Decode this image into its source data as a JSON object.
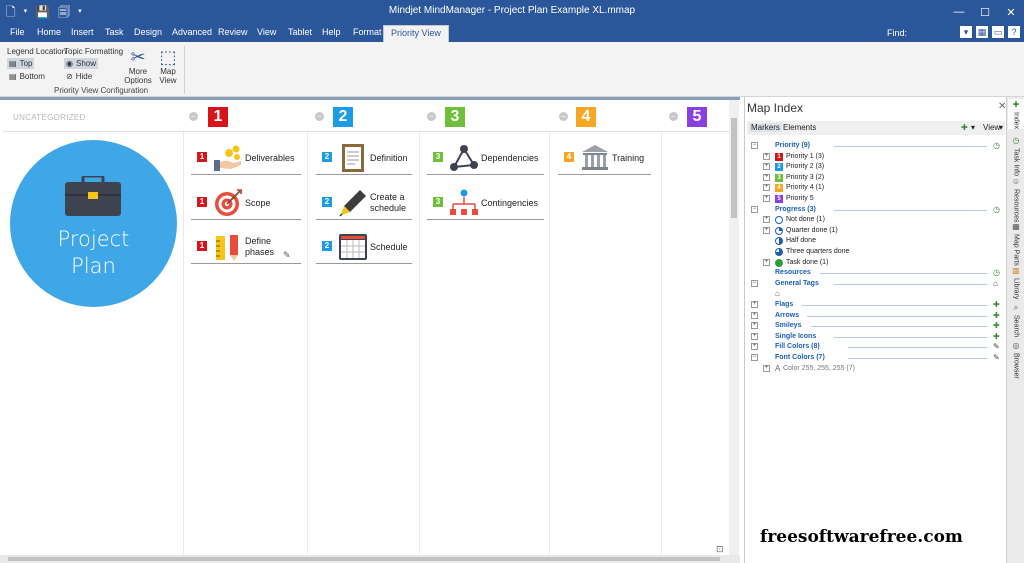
{
  "window": {
    "title": "Mindjet MindManager - Project Plan Example XL.mmap",
    "quick_access": [
      "new-doc-icon",
      "save-icon",
      "save-as-icon",
      "undo-icon"
    ],
    "controls": [
      "minimize",
      "restore",
      "close"
    ]
  },
  "ribbon_tabs": [
    "File",
    "Home",
    "Insert",
    "Task",
    "Design",
    "Advanced",
    "Review",
    "View",
    "Tablet",
    "Help",
    "Format",
    "Priority View"
  ],
  "active_tab": "Priority View",
  "find_label": "Find:",
  "ribbon": {
    "legend_location_label": "Legend Location",
    "legend_top": "Top",
    "legend_bottom": "Bottom",
    "topic_formatting_label": "Topic Formatting",
    "show": "Show",
    "hide": "Hide",
    "more_options": "More Options",
    "map_view": "Map View",
    "group_label": "Priority View Configuration"
  },
  "canvas": {
    "uncategorized_label": "UNCATEGORIZED",
    "central_topic": [
      "Project",
      "Plan"
    ],
    "columns": [
      {
        "badge": "1",
        "color": "#d7141a"
      },
      {
        "badge": "2",
        "color": "#1c9be8"
      },
      {
        "badge": "3",
        "color": "#6fbf3a"
      },
      {
        "badge": "4",
        "color": "#f5a623"
      },
      {
        "badge": "5",
        "color": "#8a3fe0"
      }
    ],
    "topics": {
      "c1": [
        {
          "badge": "1",
          "label": "Deliverables",
          "icon": "hand-coins-icon"
        },
        {
          "badge": "1",
          "label": "Scope",
          "icon": "target-icon"
        },
        {
          "badge": "1",
          "label": "Define phases",
          "icon": "ruler-pencil-icon"
        }
      ],
      "c2": [
        {
          "badge": "2",
          "label": "Definition",
          "icon": "document-icon"
        },
        {
          "badge": "2",
          "label": "Create a schedule",
          "icon": "pen-icon"
        },
        {
          "badge": "2",
          "label": "Schedule",
          "icon": "calendar-icon"
        }
      ],
      "c3": [
        {
          "badge": "3",
          "label": "Dependencies",
          "icon": "network-icon"
        },
        {
          "badge": "3",
          "label": "Contingencies",
          "icon": "hierarchy-icon"
        }
      ],
      "c4": [
        {
          "badge": "4",
          "label": "Training",
          "icon": "building-icon"
        }
      ]
    }
  },
  "map_index": {
    "title": "Map Index",
    "tabs": [
      "Markers",
      "Elements"
    ],
    "view_label": "View",
    "rows": [
      {
        "label": "Priority (9)",
        "level": 0,
        "cat": true
      },
      {
        "label": "Priority 1 (3)",
        "level": 1,
        "badge": "1",
        "color": "#d7141a"
      },
      {
        "label": "Priority 2 (3)",
        "level": 1,
        "badge": "2",
        "color": "#1c9be8"
      },
      {
        "label": "Priority 3 (2)",
        "level": 1,
        "badge": "3",
        "color": "#6fbf3a"
      },
      {
        "label": "Priority 4 (1)",
        "level": 1,
        "badge": "4",
        "color": "#f5a623"
      },
      {
        "label": "Priority 5",
        "level": 1,
        "badge": "5",
        "color": "#8a3fe0"
      },
      {
        "label": "Progress (3)",
        "level": 0,
        "cat": true
      },
      {
        "label": "Not done (1)",
        "level": 1,
        "circle": "empty"
      },
      {
        "label": "Quarter done (1)",
        "level": 1,
        "circle": "quarter"
      },
      {
        "label": "Half done",
        "level": 1,
        "circle": "half"
      },
      {
        "label": "Three quarters done",
        "level": 1,
        "circle": "three"
      },
      {
        "label": "Task done (1)",
        "level": 1,
        "circle": "done"
      },
      {
        "label": "Resources",
        "level": 0,
        "cat": true
      },
      {
        "label": "General Tags",
        "level": 0,
        "cat": true
      },
      {
        "label": "",
        "level": 1,
        "tag": true
      },
      {
        "label": "Flags",
        "level": 0,
        "cat": true
      },
      {
        "label": "Arrows",
        "level": 0,
        "cat": true
      },
      {
        "label": "Smileys",
        "level": 0,
        "cat": true
      },
      {
        "label": "Single Icons",
        "level": 0,
        "cat": true
      },
      {
        "label": "Fill Colors (8)",
        "level": 0,
        "cat": true
      },
      {
        "label": "Font Colors (7)",
        "level": 0,
        "cat": true
      },
      {
        "label": "Color 255, 255, 255 (7)",
        "level": 1,
        "fontcolor": true
      }
    ]
  },
  "side_tabs": [
    "Index",
    "Task Info",
    "Resources",
    "Map Parts",
    "Library",
    "Search",
    "Browser"
  ],
  "watermark": "freesoftwarefree.com"
}
